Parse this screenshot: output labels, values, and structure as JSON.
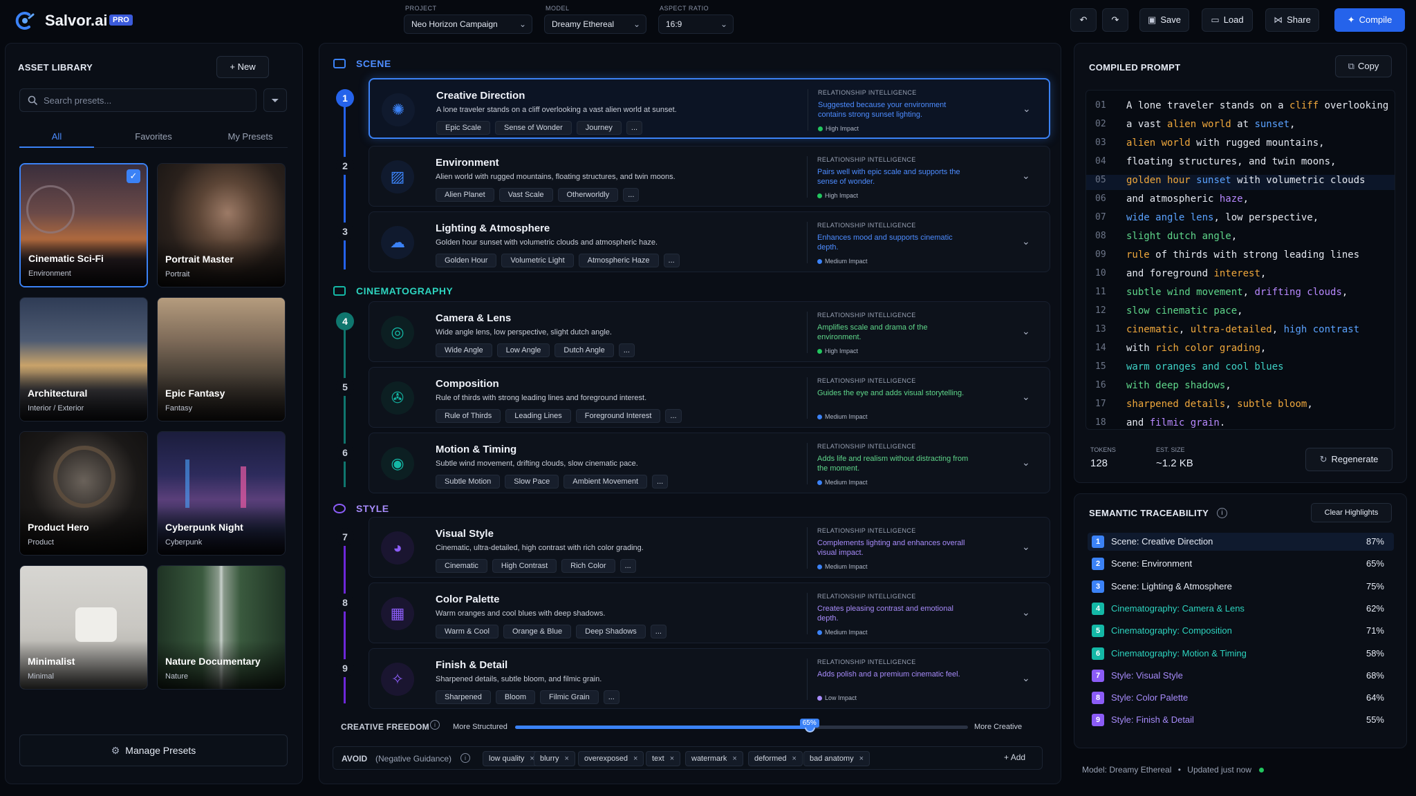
{
  "app": {
    "brand": "Salvor.ai",
    "badge": "PRO"
  },
  "topbar": {
    "project_label": "PROJECT",
    "project_value": "Neo Horizon Campaign",
    "model_label": "MODEL",
    "model_value": "Dreamy Ethereal",
    "aspect_label": "ASPECT RATIO",
    "aspect_value": "16:9",
    "save": "Save",
    "load": "Load",
    "share": "Share",
    "compile": "Compile"
  },
  "library": {
    "title": "ASSET LIBRARY",
    "new_label": "New",
    "search_placeholder": "Search presets...",
    "tabs": [
      "All",
      "Favorites",
      "My Presets"
    ],
    "cards": [
      {
        "name": "Cinematic Sci-Fi",
        "category": "Environment"
      },
      {
        "name": "Portrait Master",
        "category": "Portrait"
      },
      {
        "name": "Architectural",
        "category": "Interior / Exterior"
      },
      {
        "name": "Epic Fantasy",
        "category": "Fantasy"
      },
      {
        "name": "Product Hero",
        "category": "Product"
      },
      {
        "name": "Cyberpunk Night",
        "category": "Cyberpunk"
      },
      {
        "name": "Minimalist",
        "category": "Minimal"
      },
      {
        "name": "Nature Documentary",
        "category": "Nature"
      }
    ],
    "manage_label": "Manage Presets"
  },
  "sections": {
    "scene": "SCENE",
    "cinematography": "CINEMATOGRAPHY",
    "style": "STYLE"
  },
  "rel_heading": "RELATIONSHIP INTELLIGENCE",
  "steps": [
    {
      "num": "1",
      "title": "Creative Direction",
      "desc": "A lone traveler stands on a cliff overlooking a vast alien world at sunset.",
      "tags": [
        "Epic Scale",
        "Sense of Wonder",
        "Journey"
      ],
      "more": "...",
      "rel": "Suggested because your environment contains strong sunset lighting.",
      "impact": "High Impact"
    },
    {
      "num": "2",
      "title": "Environment",
      "desc": "Alien world with rugged mountains, floating structures, and twin moons.",
      "tags": [
        "Alien Planet",
        "Vast Scale",
        "Otherworldly"
      ],
      "more": "...",
      "rel": "Pairs well with epic scale and supports the sense of wonder.",
      "impact": "High Impact"
    },
    {
      "num": "3",
      "title": "Lighting & Atmosphere",
      "desc": "Golden hour sunset with volumetric clouds and atmospheric haze.",
      "tags": [
        "Golden Hour",
        "Volumetric Light",
        "Atmospheric Haze"
      ],
      "more": "...",
      "rel": "Enhances mood and supports cinematic depth.",
      "impact": "Medium Impact"
    },
    {
      "num": "4",
      "title": "Camera & Lens",
      "desc": "Wide angle lens, low perspective, slight dutch angle.",
      "tags": [
        "Wide Angle",
        "Low Angle",
        "Dutch Angle"
      ],
      "more": "...",
      "rel": "Amplifies scale and drama of the environment.",
      "impact": "High Impact"
    },
    {
      "num": "5",
      "title": "Composition",
      "desc": "Rule of thirds with strong leading lines and foreground interest.",
      "tags": [
        "Rule of Thirds",
        "Leading Lines",
        "Foreground Interest"
      ],
      "more": "...",
      "rel": "Guides the eye and adds visual storytelling.",
      "impact": "Medium Impact"
    },
    {
      "num": "6",
      "title": "Motion & Timing",
      "desc": "Subtle wind movement, drifting clouds, slow cinematic pace.",
      "tags": [
        "Subtle Motion",
        "Slow Pace",
        "Ambient Movement"
      ],
      "more": "...",
      "rel": "Adds life and realism without distracting from the moment.",
      "impact": "Medium Impact"
    },
    {
      "num": "7",
      "title": "Visual Style",
      "desc": "Cinematic, ultra-detailed, high contrast with rich color grading.",
      "tags": [
        "Cinematic",
        "High Contrast",
        "Rich Color"
      ],
      "more": "...",
      "rel": "Complements lighting and enhances overall visual impact.",
      "impact": "Medium Impact"
    },
    {
      "num": "8",
      "title": "Color Palette",
      "desc": "Warm oranges and cool blues with deep shadows.",
      "tags": [
        "Warm & Cool",
        "Orange & Blue",
        "Deep Shadows"
      ],
      "more": "...",
      "rel": "Creates pleasing contrast and emotional depth.",
      "impact": "Medium Impact"
    },
    {
      "num": "9",
      "title": "Finish & Detail",
      "desc": "Sharpened details, subtle bloom, and filmic grain.",
      "tags": [
        "Sharpened",
        "Bloom",
        "Filmic Grain"
      ],
      "more": "...",
      "rel": "Adds polish and a premium cinematic feel.",
      "impact": "Low Impact"
    }
  ],
  "freedom": {
    "label": "CREATIVE FREEDOM",
    "left": "More Structured",
    "right": "More Creative",
    "value_label": "65%",
    "value": 0.65
  },
  "avoid": {
    "label": "AVOID",
    "sub": "(Negative Guidance)",
    "tags": [
      "low quality",
      "blurry",
      "overexposed",
      "text",
      "watermark",
      "deformed",
      "bad anatomy"
    ],
    "add": "Add"
  },
  "compiled": {
    "title": "COMPILED PROMPT",
    "copy": "Copy",
    "lines": [
      {
        "n": "01",
        "t": "A lone traveler stands on a cliff overlooking"
      },
      {
        "n": "02",
        "t": "a vast alien world at sunset,"
      },
      {
        "n": "03",
        "t": "alien world with rugged mountains,"
      },
      {
        "n": "04",
        "t": "floating structures, and twin moons,"
      },
      {
        "n": "05",
        "t": "golden hour sunset with volumetric clouds"
      },
      {
        "n": "06",
        "t": "and atmospheric haze,"
      },
      {
        "n": "07",
        "t": "wide angle lens, low perspective,"
      },
      {
        "n": "08",
        "t": "slight dutch angle,"
      },
      {
        "n": "09",
        "t": "rule of thirds with strong leading lines"
      },
      {
        "n": "10",
        "t": "and foreground interest,"
      },
      {
        "n": "11",
        "t": "subtle wind movement, drifting clouds,"
      },
      {
        "n": "12",
        "t": "slow cinematic pace,"
      },
      {
        "n": "13",
        "t": "cinematic, ultra-detailed, high contrast"
      },
      {
        "n": "14",
        "t": "with rich color grading,"
      },
      {
        "n": "15",
        "t": "warm oranges and cool blues"
      },
      {
        "n": "16",
        "t": "with deep shadows,"
      },
      {
        "n": "17",
        "t": "sharpened details, subtle bloom,"
      },
      {
        "n": "18",
        "t": "and filmic grain."
      }
    ],
    "tokens_label": "TOKENS",
    "tokens": "128",
    "size_label": "EST. SIZE",
    "size": "~1.2 KB",
    "regenerate": "Regenerate"
  },
  "trace": {
    "title": "SEMANTIC TRACEABILITY",
    "clear": "Clear Highlights",
    "rows": [
      {
        "n": "1",
        "label": "Scene: Creative Direction",
        "pct": "87%"
      },
      {
        "n": "2",
        "label": "Scene: Environment",
        "pct": "65%"
      },
      {
        "n": "3",
        "label": "Scene: Lighting & Atmosphere",
        "pct": "75%"
      },
      {
        "n": "4",
        "label": "Cinematography: Camera & Lens",
        "pct": "62%"
      },
      {
        "n": "5",
        "label": "Cinematography: Composition",
        "pct": "71%"
      },
      {
        "n": "6",
        "label": "Cinematography: Motion & Timing",
        "pct": "58%"
      },
      {
        "n": "7",
        "label": "Style: Visual Style",
        "pct": "68%"
      },
      {
        "n": "8",
        "label": "Style: Color Palette",
        "pct": "64%"
      },
      {
        "n": "9",
        "label": "Style: Finish & Detail",
        "pct": "55%"
      }
    ]
  },
  "footer": {
    "model": "Model: Dreamy Ethereal",
    "sep": "•",
    "updated": "Updated just now"
  },
  "colors": {
    "accent": "#3b82f6",
    "scene": "#3b82f6",
    "cinematography": "#14b8a6",
    "style": "#8b5cf6",
    "high": "#22c55e",
    "medium": "#3b82f6",
    "low": "#a78bfa"
  }
}
